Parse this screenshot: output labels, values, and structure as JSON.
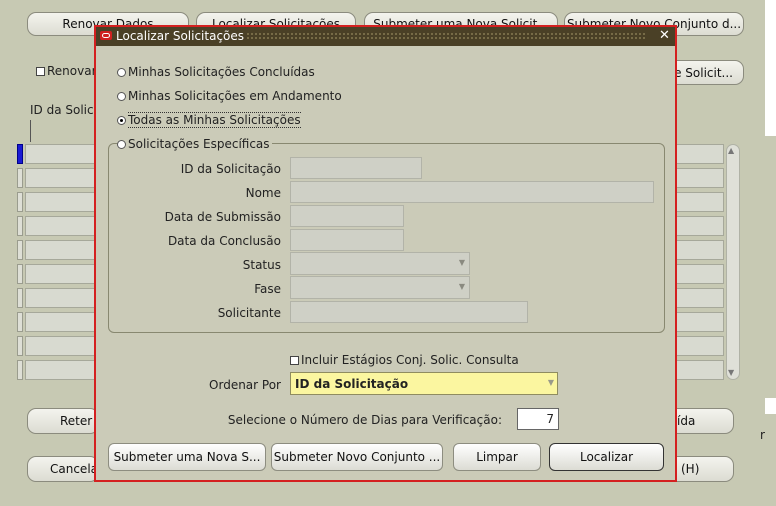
{
  "background": {
    "top_buttons": [
      "Renovar Dados",
      "Localizar Solicitações",
      "Submeter uma Nova Solicit...",
      "Submeter Novo Conjunto d..."
    ],
    "renew_checkbox_label": "Renovar",
    "right_button_label": "e Solicit...",
    "id_column_label": "ID da Solic",
    "reter_label": "Reter",
    "cancelar_label": "Cancela",
    "ida_label": "ída",
    "ajuda_label": "(H)",
    "r_label": "r"
  },
  "dialog": {
    "title": "Localizar Solicitações",
    "close_glyph": "✕",
    "radio_options": [
      {
        "label": "Minhas Solicitações Concluídas",
        "selected": false
      },
      {
        "label": "Minhas Solicitações em Andamento",
        "selected": false
      },
      {
        "label": "Todas as Minhas Solicitações",
        "selected": true
      },
      {
        "label": "Solicitações Específicas",
        "selected": false
      }
    ],
    "fields": {
      "id_label": "ID da Solicitação",
      "nome_label": "Nome",
      "data_submissao_label": "Data de Submissão",
      "data_conclusao_label": "Data da Conclusão",
      "status_label": "Status",
      "fase_label": "Fase",
      "solicitante_label": "Solicitante"
    },
    "include_stages_label": "Incluir Estágios Conj. Solic. Consulta",
    "order_by_label": "Ordenar Por",
    "order_by_value": "ID da Solicitação",
    "days_label": "Selecione o Número de Dias para Verificação:",
    "days_value": "7",
    "buttons": {
      "submit_new": "Submeter uma Nova S...",
      "submit_set": "Submeter Novo Conjunto ...",
      "clear": "Limpar",
      "find": "Localizar"
    }
  },
  "colors": {
    "dialog_border": "#d42020",
    "title_bar": "#4a4026",
    "dialog_bg": "#cbcbb8",
    "order_by_bg": "#fbf6a0",
    "background": "#c7c9b3"
  }
}
